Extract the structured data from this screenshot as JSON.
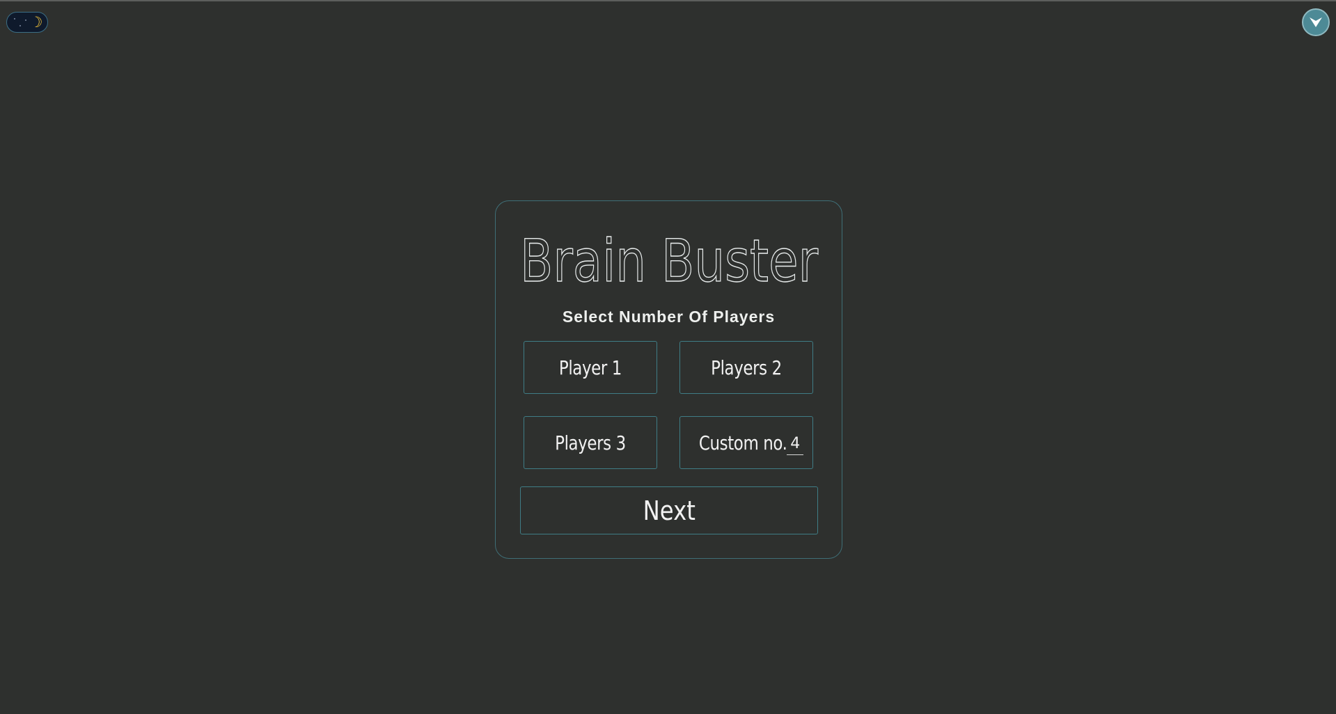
{
  "app": {
    "title": "Brain Buster",
    "subtitle": "Select Number Of Players"
  },
  "theme_toggle": {
    "mode": "dark",
    "icon": "moon-icon",
    "moon_glyph": "☽"
  },
  "menu_button": {
    "icon": "chevron-down-icon"
  },
  "options": [
    {
      "label": "Player 1"
    },
    {
      "label": "Players 2"
    },
    {
      "label": "Players 3"
    }
  ],
  "custom": {
    "label": "Custom no.",
    "value": "4"
  },
  "next_label": "Next",
  "colors": {
    "background": "#2e302e",
    "accent": "#3f7d86",
    "text": "#f2f2f2",
    "moon": "#f0c33a",
    "menu_button": "#4d8a96"
  }
}
